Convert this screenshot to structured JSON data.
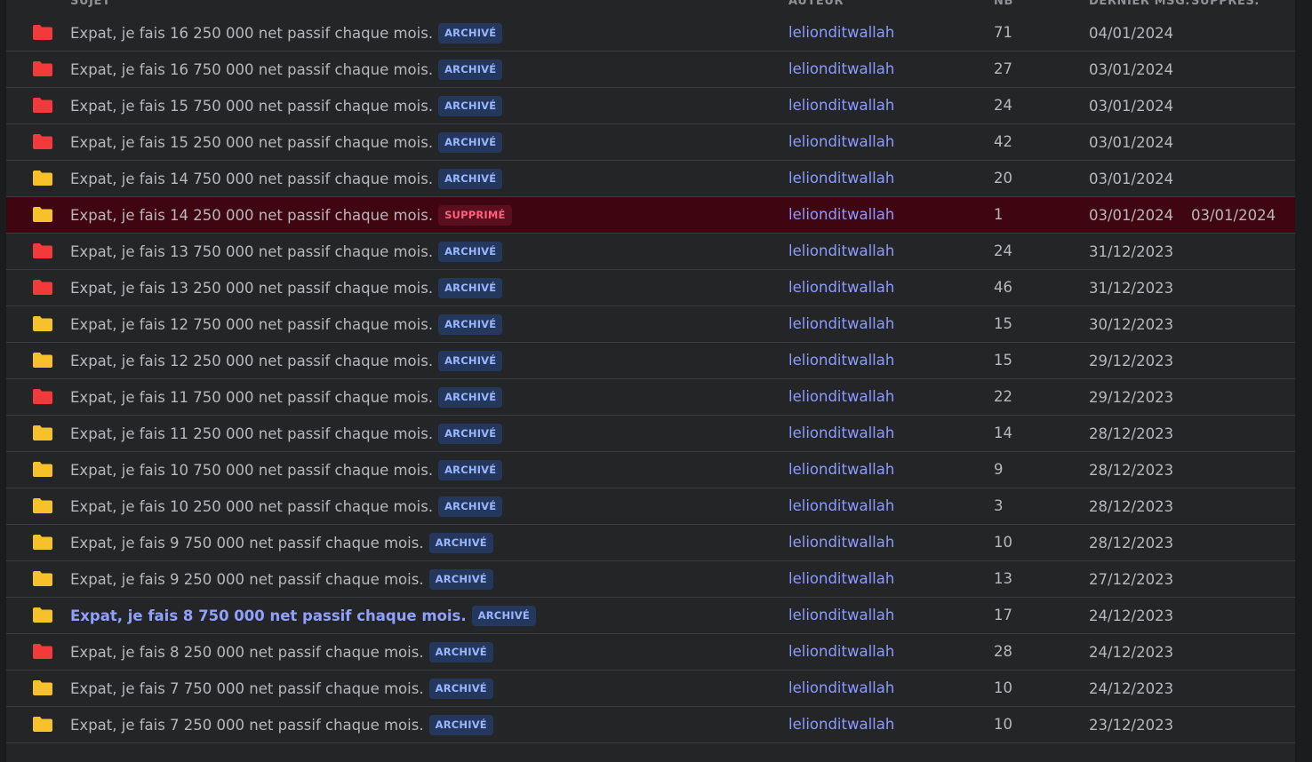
{
  "headers": {
    "subject": "SUJET",
    "author": "AUTEUR",
    "count": "NB",
    "last_message": "DERNIER MSG.",
    "deleted": "SUPPRES."
  },
  "colors": {
    "folder_red": "#f23a3a",
    "folder_yellow": "#f7c12b"
  },
  "topics": [
    {
      "folder": "red",
      "title": "Expat, je fais 16 250 000 net passif chaque mois.",
      "status": "ARCHIVÉ",
      "status_type": "archive",
      "author": "lelionditwallah",
      "count": "71",
      "last_msg": "04/01/2024",
      "deleted_date": ""
    },
    {
      "folder": "red",
      "title": "Expat, je fais 16 750 000 net passif chaque mois.",
      "status": "ARCHIVÉ",
      "status_type": "archive",
      "author": "lelionditwallah",
      "count": "27",
      "last_msg": "03/01/2024",
      "deleted_date": ""
    },
    {
      "folder": "red",
      "title": "Expat, je fais 15 750 000 net passif chaque mois.",
      "status": "ARCHIVÉ",
      "status_type": "archive",
      "author": "lelionditwallah",
      "count": "24",
      "last_msg": "03/01/2024",
      "deleted_date": ""
    },
    {
      "folder": "red",
      "title": "Expat, je fais 15 250 000 net passif chaque mois.",
      "status": "ARCHIVÉ",
      "status_type": "archive",
      "author": "lelionditwallah",
      "count": "42",
      "last_msg": "03/01/2024",
      "deleted_date": ""
    },
    {
      "folder": "yellow",
      "title": "Expat, je fais 14 750 000 net passif chaque mois.",
      "status": "ARCHIVÉ",
      "status_type": "archive",
      "author": "lelionditwallah",
      "count": "20",
      "last_msg": "03/01/2024",
      "deleted_date": ""
    },
    {
      "folder": "yellow",
      "title": "Expat, je fais 14 250 000 net passif chaque mois.",
      "status": "SUPPRIMÉ",
      "status_type": "deleted",
      "author": "lelionditwallah",
      "count": "1",
      "last_msg": "03/01/2024",
      "deleted_date": "03/01/2024"
    },
    {
      "folder": "red",
      "title": "Expat, je fais 13 750 000 net passif chaque mois.",
      "status": "ARCHIVÉ",
      "status_type": "archive",
      "author": "lelionditwallah",
      "count": "24",
      "last_msg": "31/12/2023",
      "deleted_date": ""
    },
    {
      "folder": "red",
      "title": "Expat, je fais 13 250 000 net passif chaque mois.",
      "status": "ARCHIVÉ",
      "status_type": "archive",
      "author": "lelionditwallah",
      "count": "46",
      "last_msg": "31/12/2023",
      "deleted_date": ""
    },
    {
      "folder": "yellow",
      "title": "Expat, je fais 12 750 000 net passif chaque mois.",
      "status": "ARCHIVÉ",
      "status_type": "archive",
      "author": "lelionditwallah",
      "count": "15",
      "last_msg": "30/12/2023",
      "deleted_date": ""
    },
    {
      "folder": "yellow",
      "title": "Expat, je fais 12 250 000 net passif chaque mois.",
      "status": "ARCHIVÉ",
      "status_type": "archive",
      "author": "lelionditwallah",
      "count": "15",
      "last_msg": "29/12/2023",
      "deleted_date": ""
    },
    {
      "folder": "red",
      "title": "Expat, je fais 11 750 000 net passif chaque mois.",
      "status": "ARCHIVÉ",
      "status_type": "archive",
      "author": "lelionditwallah",
      "count": "22",
      "last_msg": "29/12/2023",
      "deleted_date": ""
    },
    {
      "folder": "yellow",
      "title": "Expat, je fais 11 250 000 net passif chaque mois.",
      "status": "ARCHIVÉ",
      "status_type": "archive",
      "author": "lelionditwallah",
      "count": "14",
      "last_msg": "28/12/2023",
      "deleted_date": ""
    },
    {
      "folder": "yellow",
      "title": "Expat, je fais 10 750 000 net passif chaque mois.",
      "status": "ARCHIVÉ",
      "status_type": "archive",
      "author": "lelionditwallah",
      "count": "9",
      "last_msg": "28/12/2023",
      "deleted_date": ""
    },
    {
      "folder": "yellow",
      "title": "Expat, je fais 10 250 000 net passif chaque mois.",
      "status": "ARCHIVÉ",
      "status_type": "archive",
      "author": "lelionditwallah",
      "count": "3",
      "last_msg": "28/12/2023",
      "deleted_date": ""
    },
    {
      "folder": "yellow",
      "title": "Expat, je fais 9 750 000 net passif chaque mois.",
      "status": "ARCHIVÉ",
      "status_type": "archive",
      "author": "lelionditwallah",
      "count": "10",
      "last_msg": "28/12/2023",
      "deleted_date": ""
    },
    {
      "folder": "yellow",
      "title": "Expat, je fais 9 250 000 net passif chaque mois.",
      "status": "ARCHIVÉ",
      "status_type": "archive",
      "author": "lelionditwallah",
      "count": "13",
      "last_msg": "27/12/2023",
      "deleted_date": ""
    },
    {
      "folder": "yellow",
      "title": "Expat, je fais 8 750 000 net passif chaque mois.",
      "status": "ARCHIVÉ",
      "status_type": "archive",
      "author": "lelionditwallah",
      "count": "17",
      "last_msg": "24/12/2023",
      "deleted_date": "",
      "visited": true
    },
    {
      "folder": "red",
      "title": "Expat, je fais 8 250 000 net passif chaque mois.",
      "status": "ARCHIVÉ",
      "status_type": "archive",
      "author": "lelionditwallah",
      "count": "28",
      "last_msg": "24/12/2023",
      "deleted_date": ""
    },
    {
      "folder": "yellow",
      "title": "Expat, je fais 7 750 000 net passif chaque mois.",
      "status": "ARCHIVÉ",
      "status_type": "archive",
      "author": "lelionditwallah",
      "count": "10",
      "last_msg": "24/12/2023",
      "deleted_date": ""
    },
    {
      "folder": "yellow",
      "title": "Expat, je fais 7 250 000 net passif chaque mois.",
      "status": "ARCHIVÉ",
      "status_type": "archive",
      "author": "lelionditwallah",
      "count": "10",
      "last_msg": "23/12/2023",
      "deleted_date": ""
    }
  ]
}
